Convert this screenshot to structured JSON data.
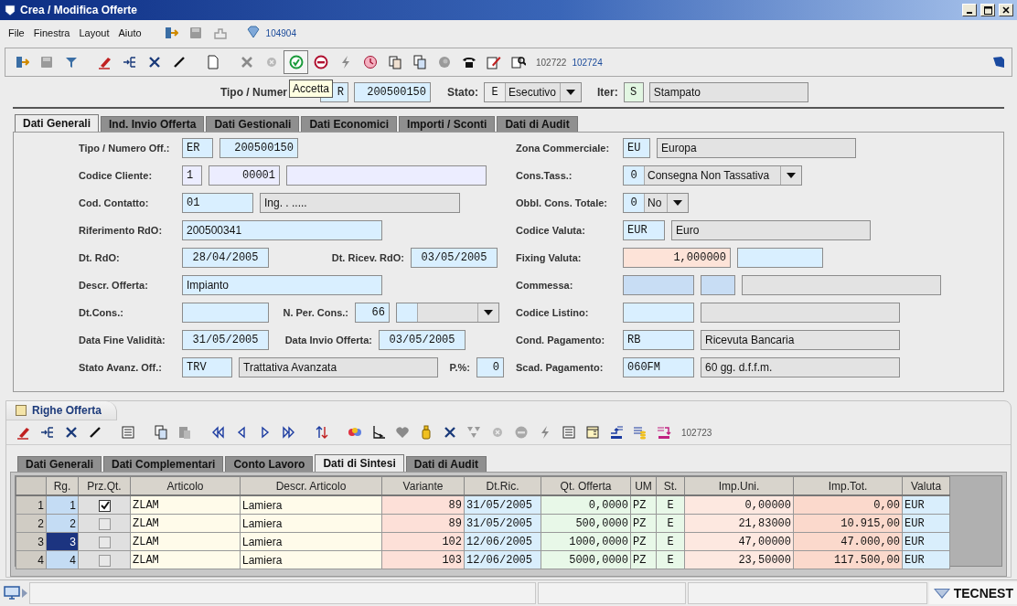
{
  "window": {
    "title": "Crea / Modifica Offerte"
  },
  "menu": [
    {
      "label": "File"
    },
    {
      "label": "Finestra"
    },
    {
      "label": "Layout"
    },
    {
      "label": "Aiuto"
    }
  ],
  "menu_code": "104904",
  "toolbar": {
    "codes": [
      {
        "text": "102722",
        "kind": "plain"
      },
      {
        "text": "102724",
        "kind": "link"
      }
    ],
    "tooltip": "Accetta"
  },
  "header": {
    "type_label": "Tipo / Numer",
    "type_code": "R",
    "number": "200500150",
    "status_label": "Stato:",
    "status_code": "E",
    "status_value": "Esecutivo",
    "iter_label": "Iter:",
    "iter_code": "S",
    "iter_value": "Stampato"
  },
  "tabs": [
    {
      "label": "Dati Generali",
      "selected": true
    },
    {
      "label": "Ind. Invio Offerta",
      "selected": false
    },
    {
      "label": "Dati Gestionali",
      "selected": false
    },
    {
      "label": "Dati Economici",
      "selected": false
    },
    {
      "label": "Importi / Sconti",
      "selected": false
    },
    {
      "label": "Dati di Audit",
      "selected": false
    }
  ],
  "form": {
    "left": [
      [
        {
          "kind": "label",
          "text": "Tipo / Numero Off.:"
        },
        {
          "kind": "code",
          "color": "#d9efff",
          "value": "ER"
        },
        {
          "kind": "number",
          "color": "#d9efff",
          "value": "200500150"
        }
      ],
      [
        {
          "kind": "label",
          "text": "Codice Cliente:"
        },
        {
          "kind": "code",
          "color": "#ecedff",
          "value": "1"
        },
        {
          "kind": "number",
          "color": "#ecedff",
          "value": "00001"
        },
        {
          "kind": "text",
          "color": "#ecedff"
        }
      ],
      [
        {
          "kind": "label",
          "text": "Cod. Contatto:"
        },
        {
          "kind": "code",
          "color": "#d9efff",
          "value": "01"
        },
        {
          "kind": "text",
          "color": "#e3e3e3",
          "value": "Ing. . ....."
        }
      ],
      [
        {
          "kind": "label",
          "text": "Riferimento RdO:"
        },
        {
          "kind": "text",
          "color": "#d9efff",
          "value": "200500341"
        }
      ],
      [
        {
          "kind": "label",
          "text": "Dt. RdO:"
        },
        {
          "kind": "date",
          "color": "#d9efff",
          "value": "28/04/2005"
        },
        {
          "kind": "label",
          "text": "Dt. Ricev. RdO:"
        },
        {
          "kind": "date",
          "color": "#d9efff",
          "value": "03/05/2005"
        }
      ],
      [
        {
          "kind": "label",
          "text": "Descr. Offerta:"
        },
        {
          "kind": "text",
          "color": "#d9efff",
          "value": "Impianto"
        }
      ],
      [
        {
          "kind": "label",
          "text": "Dt.Cons.:"
        },
        {
          "kind": "date",
          "color": "#d9efff"
        },
        {
          "kind": "label",
          "text": "N. Per. Cons.:"
        },
        {
          "kind": "number",
          "color": "#d9efff",
          "value": "66"
        },
        {
          "kind": "combo"
        }
      ],
      [
        {
          "kind": "label",
          "text": "Data Fine Validità:"
        },
        {
          "kind": "date",
          "color": "#d9efff",
          "value": "31/05/2005"
        },
        {
          "kind": "label",
          "text": "Data Invio Offerta:"
        },
        {
          "kind": "date",
          "color": "#d9efff",
          "value": "03/05/2005"
        }
      ],
      [
        {
          "kind": "label",
          "text": "Stato Avanz. Off.:"
        },
        {
          "kind": "code",
          "color": "#d9efff",
          "value": "TRV"
        },
        {
          "kind": "text",
          "color": "#e3e3e3",
          "value": "Trattativa Avanzata"
        },
        {
          "kind": "label",
          "text": "P.%:"
        },
        {
          "kind": "number",
          "color": "#d9efff",
          "value": "0"
        }
      ]
    ],
    "right": [
      [
        {
          "kind": "label",
          "text": "Zona Commerciale:"
        },
        {
          "kind": "code",
          "color": "#d9efff",
          "value": "EU"
        },
        {
          "kind": "text",
          "color": "#e3e3e3",
          "value": "Europa"
        }
      ],
      [
        {
          "kind": "label",
          "text": "Cons.Tass.:"
        },
        {
          "kind": "combo",
          "code": "0",
          "value": "Consegna Non Tassativa"
        }
      ],
      [
        {
          "kind": "label",
          "text": "Obbl. Cons. Totale:"
        },
        {
          "kind": "combo",
          "code": "0",
          "value": "No"
        }
      ],
      [
        {
          "kind": "label",
          "text": "Codice Valuta:"
        },
        {
          "kind": "code",
          "color": "#d9efff",
          "value": "EUR"
        },
        {
          "kind": "text",
          "color": "#e3e3e3",
          "value": "Euro"
        }
      ],
      [
        {
          "kind": "label",
          "text": "Fixing Valuta:"
        },
        {
          "kind": "number",
          "color": "#fde3d8",
          "value": "1,000000"
        },
        {
          "kind": "text",
          "color": "#d9efff"
        }
      ],
      [
        {
          "kind": "label",
          "text": "Commessa:"
        },
        {
          "kind": "code",
          "color": "#c8ddf4"
        },
        {
          "kind": "code",
          "color": "#c8ddf4"
        },
        {
          "kind": "text",
          "color": "#e3e3e3"
        }
      ],
      [
        {
          "kind": "label",
          "text": "Codice Listino:"
        },
        {
          "kind": "code",
          "color": "#d9efff"
        },
        {
          "kind": "text",
          "color": "#e3e3e3"
        }
      ],
      [
        {
          "kind": "label",
          "text": "Cond. Pagamento:"
        },
        {
          "kind": "code",
          "color": "#d9efff",
          "value": "RB"
        },
        {
          "kind": "text",
          "color": "#e3e3e3",
          "value": "Ricevuta Bancaria"
        }
      ],
      [
        {
          "kind": "label",
          "text": "Scad. Pagamento:"
        },
        {
          "kind": "code",
          "color": "#d9efff",
          "value": "060FM"
        },
        {
          "kind": "text",
          "color": "#e3e3e3",
          "value": "60 gg. d.f.f.m."
        }
      ]
    ]
  },
  "lines": {
    "title": "Righe Offerta",
    "code": "102723",
    "tabs": [
      {
        "label": "Dati Generali",
        "selected": false
      },
      {
        "label": "Dati Complementari",
        "selected": false
      },
      {
        "label": "Conto Lavoro",
        "selected": false
      },
      {
        "label": "Dati di Sintesi",
        "selected": true
      },
      {
        "label": "Dati di Audit",
        "selected": false
      }
    ],
    "columns": [
      "Rg.",
      "Prz.Qt.",
      "Articolo",
      "Descr. Articolo",
      "Variante",
      "Dt.Ric.",
      "Qt. Offerta",
      "UM",
      "St.",
      "Imp.Uni.",
      "Imp.Tot.",
      "Valuta"
    ],
    "rows": [
      {
        "row_header": "1",
        "selected": false,
        "checked": true,
        "cells": [
          "1",
          "",
          "ZLAM",
          "Lamiera",
          "89",
          "31/05/2005",
          "0,0000",
          "PZ",
          "E",
          "0,00000",
          "0,00",
          "EUR"
        ]
      },
      {
        "row_header": "2",
        "selected": false,
        "checked": false,
        "cells": [
          "2",
          "",
          "ZLAM",
          "Lamiera",
          "89",
          "31/05/2005",
          "500,0000",
          "PZ",
          "E",
          "21,83000",
          "10.915,00",
          "EUR"
        ]
      },
      {
        "row_header": "3",
        "selected": true,
        "checked": false,
        "cells": [
          "3",
          "",
          "ZLAM",
          "Lamiera",
          "102",
          "12/06/2005",
          "1000,0000",
          "PZ",
          "E",
          "47,00000",
          "47.000,00",
          "EUR"
        ]
      },
      {
        "row_header": "4",
        "selected": false,
        "checked": false,
        "cells": [
          "4",
          "",
          "ZLAM",
          "Lamiera",
          "103",
          "12/06/2005",
          "5000,0000",
          "PZ",
          "E",
          "23,50000",
          "117.500,00",
          "EUR"
        ]
      }
    ]
  },
  "status_bar": {
    "logo": "TECNEST"
  }
}
